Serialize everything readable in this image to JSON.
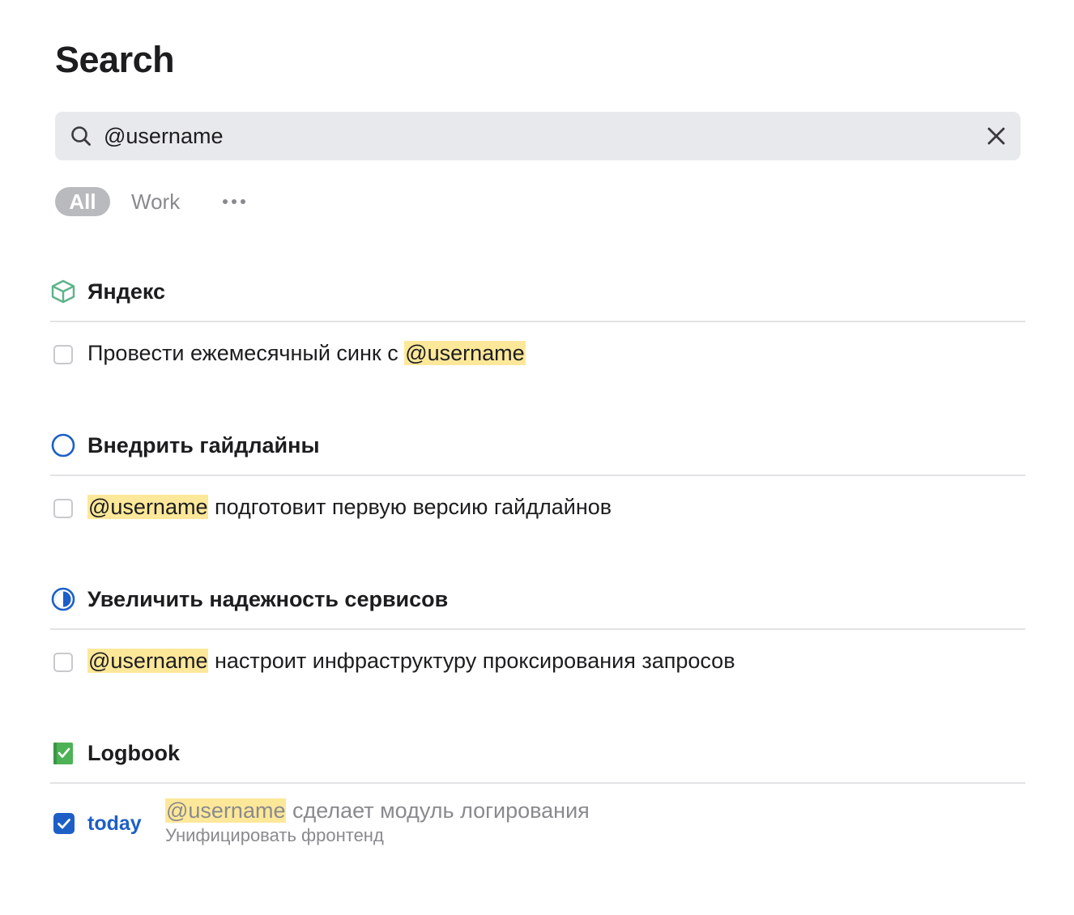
{
  "page": {
    "title": "Search"
  },
  "search": {
    "value": "@username",
    "placeholder": "Search"
  },
  "filters": {
    "all_label": "All",
    "work_label": "Work",
    "more_icon": "ellipsis-icon"
  },
  "colors": {
    "accent": "#1d5fc7",
    "highlight": "#fde89a",
    "area_icon": "#5cb38a",
    "logbook_icon": "#4cb255"
  },
  "sections": [
    {
      "title": "Яндекс",
      "icon": "area-box-icon",
      "tasks": [
        {
          "text_before": "Провести ежемесячный синк с ",
          "highlight": "@username",
          "text_after": "",
          "checked": false
        }
      ]
    },
    {
      "title": "Внедрить гайдлайны",
      "icon": "project-circle-icon",
      "tasks": [
        {
          "text_before": "",
          "highlight": "@username",
          "text_after": " подготовит первую версию гайдлайнов",
          "checked": false
        }
      ]
    },
    {
      "title": "Увеличить надежность сервисов",
      "icon": "project-half-circle-icon",
      "tasks": [
        {
          "text_before": "",
          "highlight": "@username",
          "text_after": " настроит инфраструктуру проксирования запросов",
          "checked": false
        }
      ]
    },
    {
      "title": "Logbook",
      "icon": "logbook-icon",
      "tasks": [
        {
          "date": "today",
          "highlight": "@username",
          "text_after": " сделает модуль логирования",
          "project": "Унифицировать фронтенд",
          "checked": true
        }
      ]
    }
  ]
}
